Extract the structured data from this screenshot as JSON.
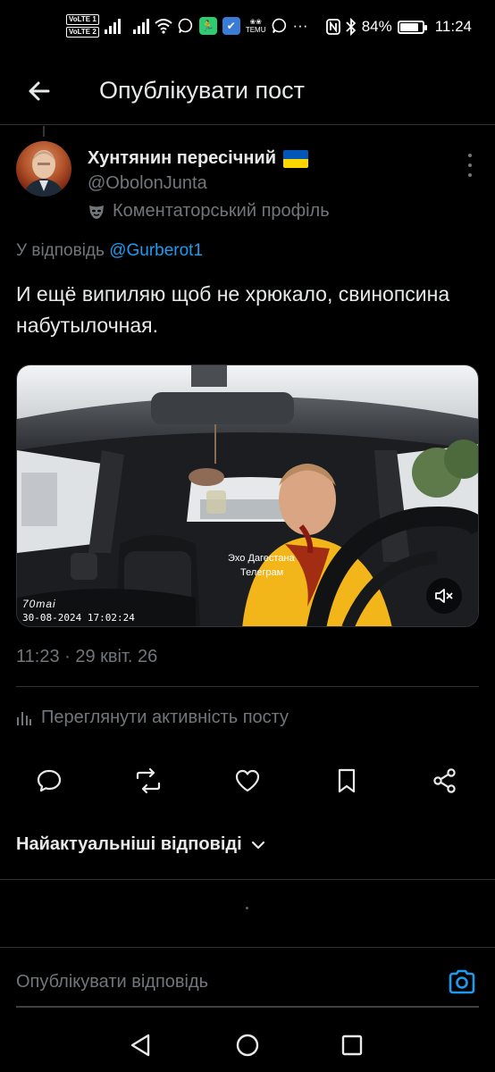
{
  "status_bar": {
    "volte_1": "VoLTE 1",
    "volte_2": "VoLTE 2",
    "temu": "TEMU",
    "battery_percent": "84%",
    "battery_level": 0.84,
    "time": "11:24",
    "icons": [
      "signal-icon",
      "signal-icon",
      "wifi-icon",
      "viber-icon",
      "fitness-app-icon",
      "shield-app-icon",
      "temu-app-icon",
      "viber-icon",
      "more-notifications-icon",
      "nfc-icon",
      "bluetooth-icon",
      "battery-icon"
    ]
  },
  "header": {
    "title": "Опублікувати пост",
    "back_icon": "arrow-left-icon"
  },
  "post": {
    "author_name": "Хунтянин пересічний",
    "author_flag": "flag-ukraine",
    "flag_colors": [
      "#0057b7",
      "#ffd700"
    ],
    "author_handle": "@ObolonJunta",
    "profile_label": "Коментаторський профіль",
    "profile_icon": "mask-icon",
    "reply_prefix": "У відповідь",
    "reply_mention": "@Gurberot1",
    "text": "И ещё випиляю щоб не хрюкало, свинопсина набутылочная.",
    "video": {
      "watermark_line1": "Эхо Дагестана",
      "watermark_line2": "Телеграм",
      "camera_brand": "70mai",
      "camera_timestamp": "30-08-2024 17:02:24",
      "mute_icon": "speaker-muted-icon"
    },
    "timestamp": "11:23 · 29 квіт. 26"
  },
  "activity": {
    "label": "Переглянути активність посту",
    "icon": "bar-chart-icon"
  },
  "actions": [
    {
      "name": "reply",
      "icon": "comment-icon"
    },
    {
      "name": "repost",
      "icon": "repost-icon"
    },
    {
      "name": "like",
      "icon": "heart-icon"
    },
    {
      "name": "bookmark",
      "icon": "bookmark-icon"
    },
    {
      "name": "share",
      "icon": "share-icon"
    }
  ],
  "sort": {
    "label": "Найактуальніші відповіді",
    "icon": "chevron-down-icon"
  },
  "reply_box": {
    "placeholder": "Опублікувати відповідь",
    "camera_icon": "camera-icon"
  },
  "colors": {
    "background": "#000000",
    "text_primary": "#e7e9ea",
    "text_secondary": "#71767b",
    "accent": "#1d9bf0",
    "divider": "#2f3336"
  }
}
